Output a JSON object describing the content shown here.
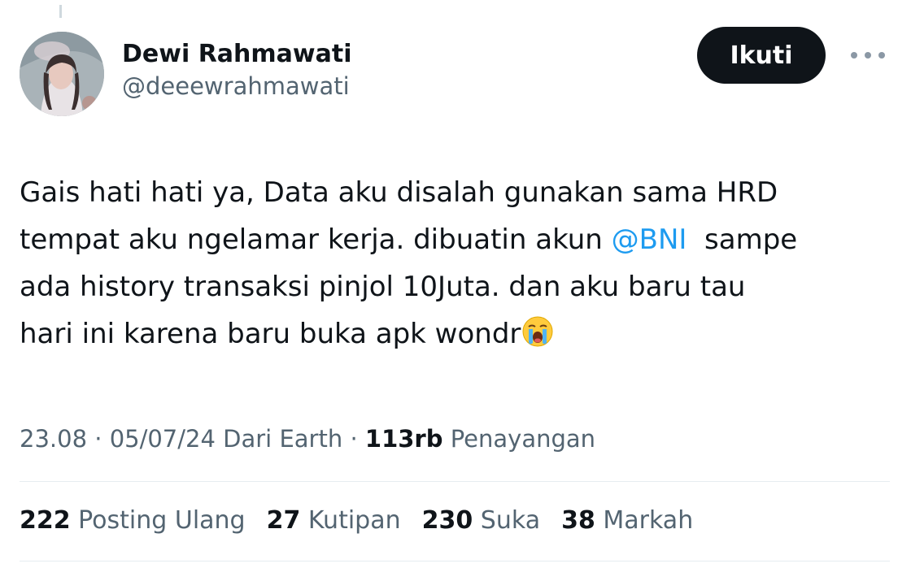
{
  "tweet": {
    "author": {
      "display_name": "Dewi Rahmawati",
      "handle": "@deeewrahmawati"
    },
    "follow_label": "Ikuti",
    "more_icon": "more-horizontal-icon",
    "text": {
      "line1": "Gais hati hati ya, Data aku disalah gunakan sama HRD",
      "line2_before": "tempat aku ngelamar kerja. dibuatin akun ",
      "mention": "@BNI",
      "line2_after": "  sampe",
      "line3": "ada history transaksi pinjol 10Juta. dan aku baru tau",
      "line4": "hari ini karena baru buka apk wondr",
      "emoji": "loudly-crying-face"
    },
    "meta": {
      "time": "23.08",
      "sep1": " · ",
      "date": "05/07/24",
      "source": " Dari Earth",
      "sep2": " · ",
      "views_count": "113rb",
      "views_label": " Penayangan"
    },
    "stats": {
      "reposts_count": "222",
      "reposts_label": " Posting Ulang",
      "quotes_count": "27",
      "quotes_label": " Kutipan",
      "likes_count": "230",
      "likes_label": " Suka",
      "bookmarks_count": "38",
      "bookmarks_label": " Markah"
    }
  },
  "colors": {
    "text_primary": "#0f1419",
    "text_secondary": "#536471",
    "link": "#1d9bf0",
    "button_bg": "#0f1419",
    "divider": "#e6ecf0"
  }
}
